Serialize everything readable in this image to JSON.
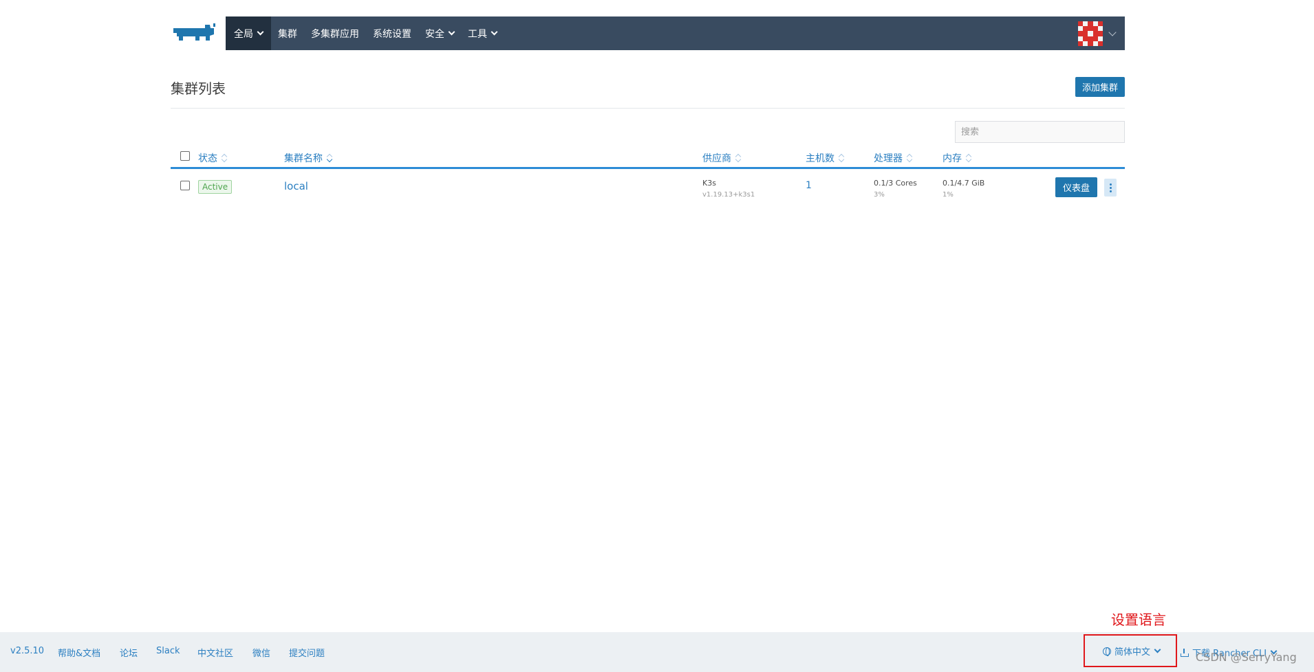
{
  "header": {
    "logo": "rancher-logo",
    "nav": [
      {
        "label": "全局",
        "active": true,
        "dropdown": true
      },
      {
        "label": "集群",
        "active": false,
        "dropdown": false
      },
      {
        "label": "多集群应用",
        "active": false,
        "dropdown": false
      },
      {
        "label": "系统设置",
        "active": false,
        "dropdown": false
      },
      {
        "label": "安全",
        "active": false,
        "dropdown": true
      },
      {
        "label": "工具",
        "active": false,
        "dropdown": true
      }
    ],
    "avatar": "user-avatar"
  },
  "page": {
    "title": "集群列表",
    "add_button": "添加集群",
    "search_placeholder": "搜索"
  },
  "table": {
    "columns": [
      "状态",
      "集群名称",
      "供应商",
      "主机数",
      "处理器",
      "内存"
    ],
    "rows": [
      {
        "state": "Active",
        "name": "local",
        "provider": "K3s",
        "provider_version": "v1.19.13+k3s1",
        "hosts": "1",
        "cpu": "0.1/3 Cores",
        "cpu_pct": "3%",
        "memory": "0.1/4.7 GiB",
        "memory_pct": "1%",
        "dashboard_button": "仪表盘"
      }
    ]
  },
  "footer": {
    "version": "v2.5.10",
    "links": [
      "帮助&文档",
      "论坛",
      "Slack",
      "中文社区",
      "微信",
      "提交问题"
    ],
    "language": "简体中文",
    "download": "下载 Rancher CLI"
  },
  "annotation": {
    "text": "设置语言",
    "color": "#e0171b"
  },
  "watermark": "CSDN @SerryYang",
  "colors": {
    "nav_bg": "#394b60",
    "nav_active": "#22303f",
    "primary": "#1f76ae",
    "link": "#2b7fc1",
    "active_badge": "#4ea44e"
  }
}
